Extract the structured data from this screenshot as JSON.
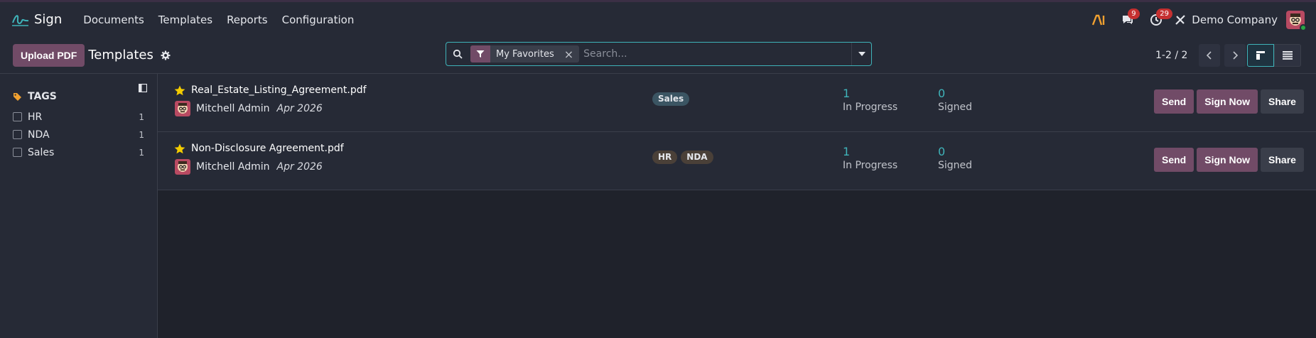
{
  "app": {
    "name": "Sign"
  },
  "menu": [
    "Documents",
    "Templates",
    "Reports",
    "Configuration"
  ],
  "systray": {
    "ai_label": "AI",
    "messages_count": "9",
    "activities_count": "29",
    "company": "Demo Company"
  },
  "control": {
    "upload_label": "Upload PDF",
    "title": "Templates",
    "search": {
      "facet": "My Favorites",
      "placeholder": "Search..."
    },
    "pager": "1-2 / 2"
  },
  "sidebar": {
    "heading": "TAGS",
    "tags": [
      {
        "label": "HR",
        "count": "1"
      },
      {
        "label": "NDA",
        "count": "1"
      },
      {
        "label": "Sales",
        "count": "1"
      }
    ]
  },
  "templates": [
    {
      "name": "Real_Estate_Listing_Agreement.pdf",
      "author": "Mitchell Admin",
      "date": "Apr 2026",
      "tags": [
        "Sales"
      ],
      "in_progress": "1",
      "in_progress_label": "In Progress",
      "signed": "0",
      "signed_label": "Signed",
      "send_label": "Send",
      "sign_now_label": "Sign Now",
      "share_label": "Share"
    },
    {
      "name": "Non-Disclosure Agreement.pdf",
      "author": "Mitchell Admin",
      "date": "Apr 2026",
      "tags": [
        "HR",
        "NDA"
      ],
      "in_progress": "1",
      "in_progress_label": "In Progress",
      "signed": "0",
      "signed_label": "Signed",
      "send_label": "Send",
      "sign_now_label": "Sign Now",
      "share_label": "Share"
    }
  ],
  "colors": {
    "brand": "#714b67",
    "accent": "#3fb3b9",
    "star": "#f3cc00",
    "tag_sales": "#3b5563",
    "tag_hr": "#4a4038",
    "tag_nda": "#4a4038"
  }
}
